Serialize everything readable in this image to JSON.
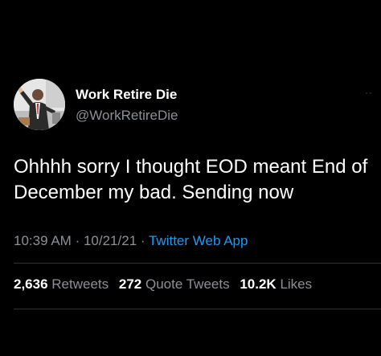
{
  "author": {
    "name": "Work Retire Die",
    "handle": "@WorkRetireDie",
    "avatar_icon": "profile-avatar"
  },
  "menu": {
    "icon": "more-dots-icon"
  },
  "tweet": {
    "text": "Ohhhh sorry I thought EOD meant End of December my bad. Sending now"
  },
  "meta": {
    "time": "10:39 AM",
    "separator": "·",
    "date": "10/21/21",
    "source": "Twitter Web App"
  },
  "stats": {
    "retweets_count": "2,636",
    "retweets_label": "Retweets",
    "quotes_count": "272",
    "quotes_label": "Quote Tweets",
    "likes_count": "10.2K",
    "likes_label": "Likes"
  },
  "colors": {
    "background": "#000000",
    "primary_text": "#ffffff",
    "secondary_text": "#8b9096",
    "link": "#1d9bf0",
    "divider": "#2f3336"
  }
}
